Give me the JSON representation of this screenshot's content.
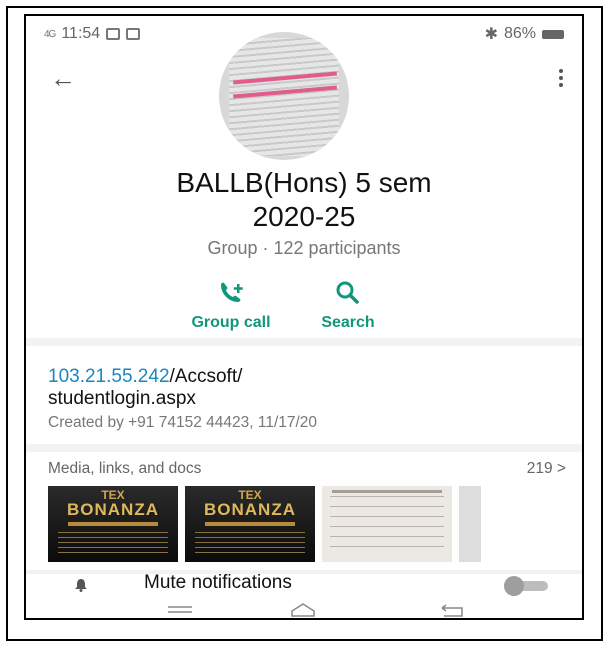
{
  "status_bar": {
    "signal": "4G",
    "time": "11:54",
    "battery": "86%"
  },
  "header": {
    "back_icon": "arrow-left-icon",
    "menu_icon": "more-vert-icon"
  },
  "group": {
    "name": "BALLB(Hons) 5 sem\n2020-25",
    "subtitle": "Group · 122 participants"
  },
  "actions": {
    "group_call": "Group call",
    "search": "Search"
  },
  "description": {
    "link": "103.21.55.242",
    "rest": "/Accsoft/\nstudentlogin.aspx",
    "created": "Created by +91 74152 44423, 11/17/20"
  },
  "media": {
    "label": "Media, links, and docs",
    "count": "219 >",
    "thumbs": [
      {
        "kind": "poster",
        "line1": "TEX",
        "line2": "BONANZA"
      },
      {
        "kind": "poster",
        "line1": "TEX",
        "line2": "BONANZA"
      },
      {
        "kind": "paper"
      },
      {
        "kind": "partial"
      }
    ]
  },
  "settings": {
    "mute_label": "Mute notifications"
  },
  "colors": {
    "accent": "#12977c",
    "link": "#1a86c2"
  }
}
